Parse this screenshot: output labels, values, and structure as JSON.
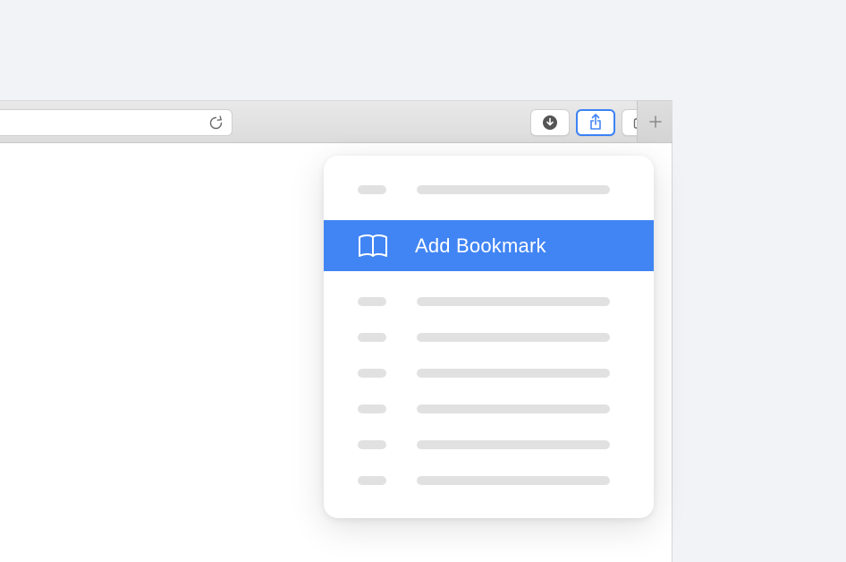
{
  "toolbar": {
    "share_button_active": true
  },
  "share_menu": {
    "items": [
      {
        "type": "placeholder"
      },
      {
        "type": "action",
        "label": "Add Bookmark",
        "icon": "book-icon",
        "highlighted": true
      },
      {
        "type": "placeholder"
      },
      {
        "type": "placeholder"
      },
      {
        "type": "placeholder"
      },
      {
        "type": "placeholder"
      },
      {
        "type": "placeholder"
      },
      {
        "type": "placeholder"
      }
    ]
  }
}
